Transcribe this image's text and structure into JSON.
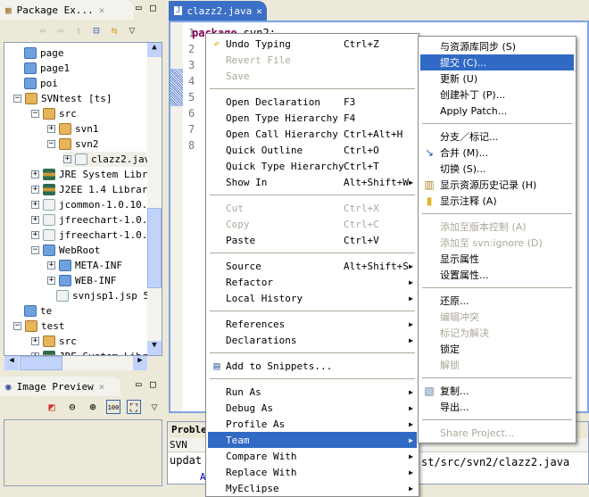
{
  "package_explorer": {
    "title": "Package Ex...",
    "tree": [
      {
        "label": "page",
        "level": 1,
        "icon": "folder-icon"
      },
      {
        "label": "page1",
        "level": 1,
        "icon": "folder-icon"
      },
      {
        "label": "poi",
        "level": 1,
        "icon": "folder-icon"
      },
      {
        "label": "SVNtest [ts]",
        "level": 1,
        "icon": "project-icon",
        "expander": "−"
      },
      {
        "label": "src",
        "level": 2,
        "icon": "source-folder-icon",
        "expander": "−"
      },
      {
        "label": "svn1",
        "level": 3,
        "icon": "package-icon",
        "expander": "+"
      },
      {
        "label": "svn2",
        "level": 3,
        "icon": "package-icon",
        "expander": "−"
      },
      {
        "label": "clazz2.jav",
        "level": 4,
        "icon": "java-file-icon",
        "expander": "+"
      },
      {
        "label": "JRE System Librar",
        "level": 2,
        "icon": "library-icon",
        "expander": "+"
      },
      {
        "label": "J2EE 1.4 Library",
        "level": 2,
        "icon": "library-icon",
        "expander": "+"
      },
      {
        "label": "jcommon-1.0.10.j",
        "level": 2,
        "icon": "jar-icon",
        "expander": "+"
      },
      {
        "label": "jfreechart-1.0.6-",
        "level": 2,
        "icon": "jar-icon",
        "expander": "+"
      },
      {
        "label": "jfreechart-1.0.6-",
        "level": 2,
        "icon": "jar-icon",
        "expander": "+"
      },
      {
        "label": "WebRoot",
        "level": 2,
        "icon": "folder-icon",
        "expander": "−"
      },
      {
        "label": "META-INF",
        "level": 3,
        "icon": "folder-icon",
        "expander": "+"
      },
      {
        "label": "WEB-INF",
        "level": 3,
        "icon": "folder-icon",
        "expander": "+"
      },
      {
        "label": "svnjsp1.jsp 5'",
        "level": 3,
        "icon": "jsp-file-icon"
      },
      {
        "label": "te",
        "level": 1,
        "icon": "folder-icon"
      },
      {
        "label": "test",
        "level": 1,
        "icon": "project-icon",
        "expander": "−"
      },
      {
        "label": "src",
        "level": 2,
        "icon": "source-folder-icon",
        "expander": "+"
      },
      {
        "label": "JRE System Librar",
        "level": 2,
        "icon": "library-icon",
        "expander": "+"
      }
    ]
  },
  "image_preview": {
    "title": "Image Preview",
    "zoom_label": "100"
  },
  "editor": {
    "tab": "clazz2.java",
    "line_numbers": [
      "1",
      "2",
      "3",
      "4",
      "5",
      "6",
      "7",
      "8"
    ],
    "line1_keyword": "package",
    "line1_rest": " svn2;"
  },
  "bottom": {
    "tab": "Proble",
    "col": "SVN",
    "line1_left": "updat",
    "line1_right": "st/src/svn2/clazz2.java",
    "line2": "A"
  },
  "context_menu": {
    "groups": [
      [
        {
          "label": "Undo Typing",
          "accel": "Ctrl+Z",
          "icon": "undo-icon"
        },
        {
          "label": "Revert File",
          "disabled": true
        },
        {
          "label": "Save",
          "disabled": true
        }
      ],
      [
        {
          "label": "Open Declaration",
          "accel": "F3"
        },
        {
          "label": "Open Type Hierarchy",
          "accel": "F4"
        },
        {
          "label": "Open Call Hierarchy",
          "accel": "Ctrl+Alt+H"
        },
        {
          "label": "Quick Outline",
          "accel": "Ctrl+O"
        },
        {
          "label": "Quick Type Hierarchy",
          "accel": "Ctrl+T"
        },
        {
          "label": "Show In",
          "accel": "Alt+Shift+W",
          "submenu": true
        }
      ],
      [
        {
          "label": "Cut",
          "accel": "Ctrl+X",
          "disabled": true
        },
        {
          "label": "Copy",
          "accel": "Ctrl+C",
          "disabled": true
        },
        {
          "label": "Paste",
          "accel": "Ctrl+V"
        }
      ],
      [
        {
          "label": "Source",
          "accel": "Alt+Shift+S",
          "submenu": true
        },
        {
          "label": "Refactor",
          "submenu": true
        },
        {
          "label": "Local History",
          "submenu": true
        }
      ],
      [
        {
          "label": "References",
          "submenu": true
        },
        {
          "label": "Declarations",
          "submenu": true
        }
      ],
      [
        {
          "label": "Add to Snippets...",
          "icon": "snippet-icon"
        }
      ],
      [
        {
          "label": "Run As",
          "submenu": true
        },
        {
          "label": "Debug As",
          "submenu": true
        },
        {
          "label": "Profile As",
          "submenu": true
        },
        {
          "label": "Team",
          "submenu": true,
          "selected": true
        },
        {
          "label": "Compare With",
          "submenu": true
        },
        {
          "label": "Replace With",
          "submenu": true
        },
        {
          "label": "MyEclipse",
          "submenu": true
        }
      ]
    ]
  },
  "team_menu": {
    "groups": [
      [
        {
          "label": "与资源库同步 (S)"
        },
        {
          "label": "提交 (C)...",
          "selected": true
        },
        {
          "label": "更新 (U)"
        },
        {
          "label": "创建补丁 (P)..."
        },
        {
          "label": "Apply Patch..."
        }
      ],
      [
        {
          "label": "分支／标记..."
        },
        {
          "label": "合并 (M)...",
          "icon": "merge-icon"
        },
        {
          "label": "切换 (S)..."
        },
        {
          "label": "显示资源历史记录 (H)",
          "icon": "history-icon"
        },
        {
          "label": "显示注释 (A)",
          "icon": "annotate-icon"
        }
      ],
      [
        {
          "label": "添加至版本控制 (A)",
          "disabled": true
        },
        {
          "label": "添加至 svn:ignore (D)",
          "disabled": true
        },
        {
          "label": "显示属性"
        },
        {
          "label": "设置属性..."
        }
      ],
      [
        {
          "label": "还原..."
        },
        {
          "label": "编辑冲突",
          "disabled": true
        },
        {
          "label": "标记为解决",
          "disabled": true
        },
        {
          "label": "锁定"
        },
        {
          "label": "解锁",
          "disabled": true
        }
      ],
      [
        {
          "label": "复制...",
          "icon": "copy-icon"
        },
        {
          "label": "导出..."
        }
      ],
      [
        {
          "label": "Share Project...",
          "disabled": true
        }
      ]
    ]
  },
  "colors": {
    "selection": "#316ac5",
    "keyword": "#7f0055",
    "disabled": "#aca899"
  }
}
